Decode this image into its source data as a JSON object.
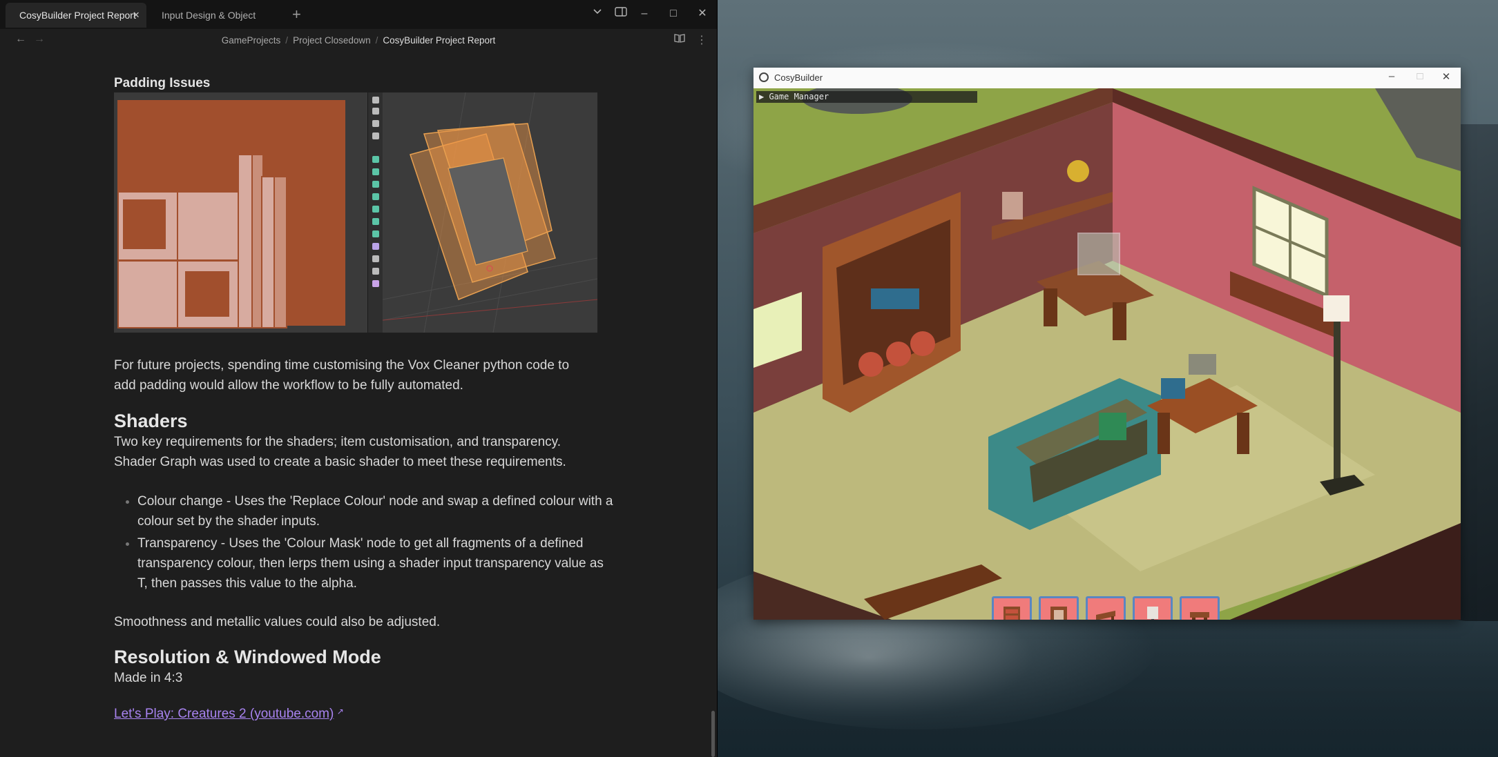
{
  "obsidian": {
    "tabs": [
      {
        "label": "CosyBuilder Project Report",
        "active": true
      },
      {
        "label": "Input Design & Object States",
        "active": false
      }
    ],
    "breadcrumb": [
      "GameProjects",
      "Project Closedown",
      "CosyBuilder Project Report"
    ],
    "note": {
      "padding_heading": "Padding Issues",
      "padding_para": "For future projects, spending time customising the Vox Cleaner python code to add padding would allow the workflow to be fully automated.",
      "shaders_heading": "Shaders",
      "shaders_para": "Two key requirements for the shaders; item customisation, and transparency. Shader Graph was used to create a basic shader to meet these requirements.",
      "bullets": [
        "Colour change - Uses the 'Replace Colour' node and swap a defined colour with a colour set by the shader inputs.",
        "Transparency - Uses the 'Colour Mask' node to get all fragments of a defined transparency colour, then lerps them using a shader input transparency value as T, then passes this value to the alpha."
      ],
      "smoothness_para": "Smoothness and metallic values could also be adjusted.",
      "resolution_heading": "Resolution & Windowed Mode",
      "resolution_para": "Made in 4:3",
      "link_text": "Let's Play: Creatures 2 (youtube.com)"
    }
  },
  "cosybuilder": {
    "window_title": "CosyBuilder",
    "game_manager_label": "Game Manager",
    "hotbar_items": [
      "bookshelf-icon",
      "window-icon",
      "shelf-icon",
      "lamp-icon",
      "table-icon"
    ]
  },
  "colors": {
    "accent_link": "#a883f0",
    "uv_background": "#a14f2d",
    "hotbar_slot": "#f07b7b",
    "hotbar_border": "#5a86c2"
  }
}
